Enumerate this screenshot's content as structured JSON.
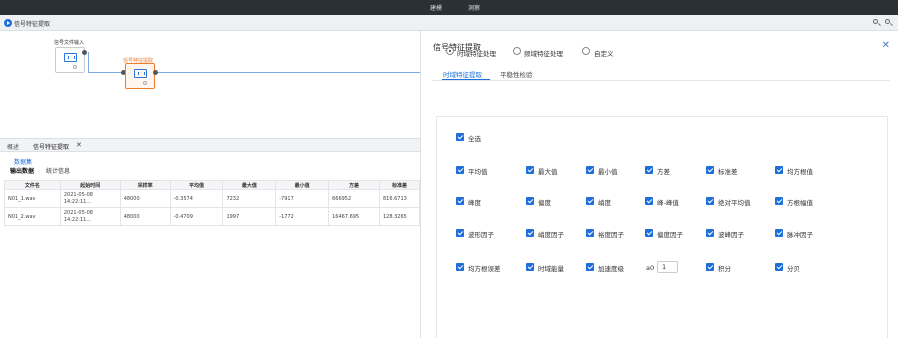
{
  "topbar": {
    "tabs": [
      "建模",
      "洞察"
    ]
  },
  "titlebar": {
    "title": "信号特征提取"
  },
  "canvas": {
    "nodes": [
      {
        "label": "信号文件输入"
      },
      {
        "label": "信号特征提取"
      }
    ]
  },
  "bottom": {
    "tabs": [
      "概述",
      "信号特征提取"
    ],
    "dataset_link": "数据集",
    "sub_tabs": [
      "输出数据",
      "统计信息"
    ],
    "table": {
      "headers": [
        "文件名",
        "起始时间",
        "采样率",
        "平均值",
        "最大值",
        "最小值",
        "方差",
        "标准差"
      ],
      "rows": [
        [
          "N01_1.wav",
          "2021-05-08 14:22:11...",
          "48000",
          "-0.3574",
          "7232",
          "-7917",
          "666952",
          "816.6713"
        ],
        [
          "N01_2.wav",
          "2021-05-08 14:22:11...",
          "48000",
          "-0.4709",
          "1997",
          "-1772",
          "16467.695",
          "128.3265"
        ]
      ]
    }
  },
  "panel": {
    "title": "信号特征提取",
    "radios": [
      "时域特征处理",
      "频域特征处理",
      "自定义"
    ],
    "tabs": [
      "时域特征提取",
      "平稳性检验"
    ],
    "select_all": "全选",
    "features": {
      "row1": [
        "平均值",
        "最大值",
        "最小值",
        "方差",
        "标准差",
        "均方根值"
      ],
      "row2": [
        "峰度",
        "偏度",
        "峭度",
        "峰-峰值",
        "绝对平均值",
        "方根幅值"
      ],
      "row3": [
        "波形因子",
        "峭度因子",
        "裕度因子",
        "偏度因子",
        "波峰因子",
        "脉冲因子"
      ],
      "row4": [
        "均方根误差",
        "时域能量",
        "加速度级",
        "积分",
        "分贝"
      ]
    },
    "a0_label": "a0",
    "a0_value": "1"
  },
  "colors": {
    "accent": "#1e6fd9",
    "active_node": "#f07b2a",
    "topbar": "#2b2f36"
  }
}
